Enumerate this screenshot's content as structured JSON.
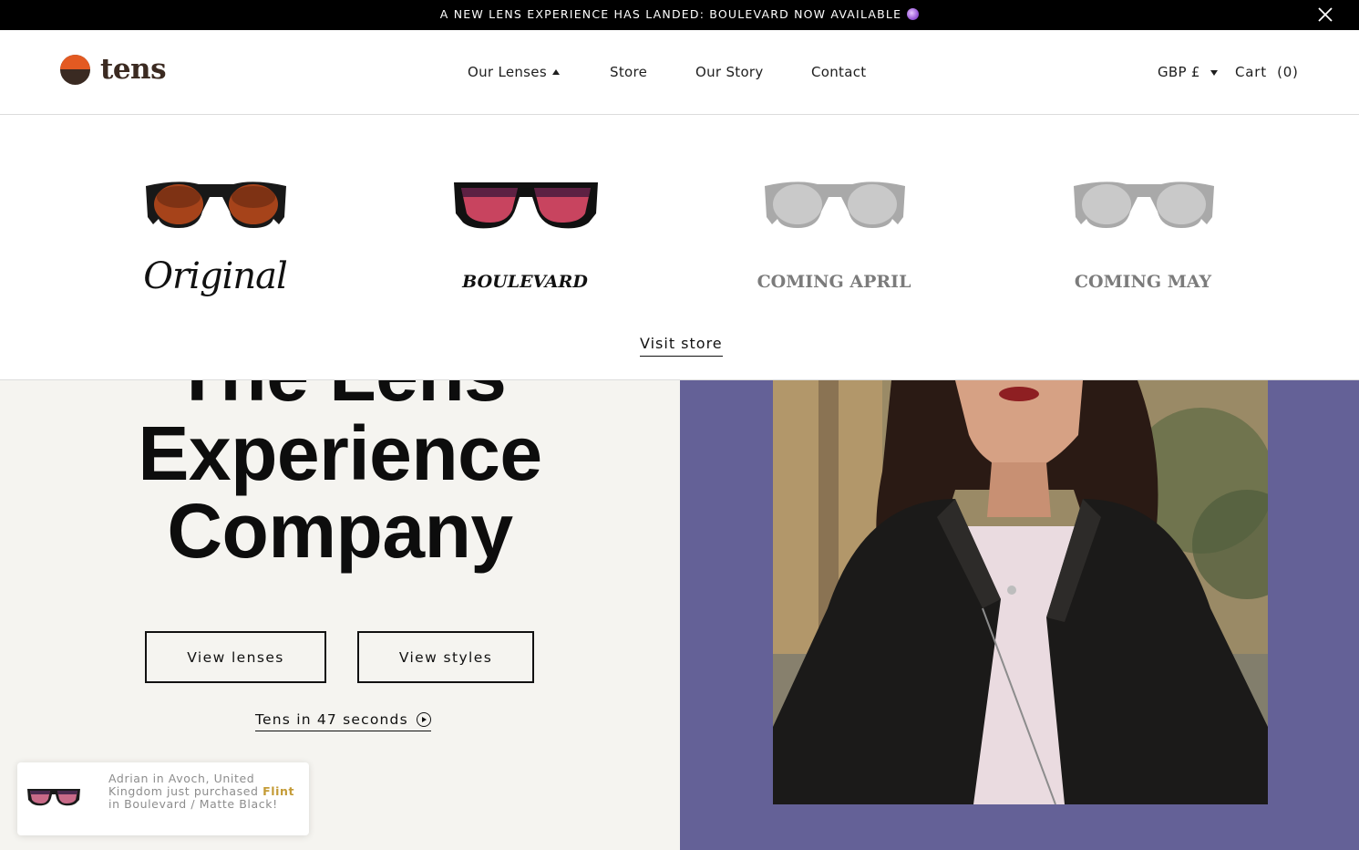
{
  "announcement": {
    "text": "A NEW LENS EXPERIENCE HAS LANDED: BOULEVARD NOW AVAILABLE",
    "emoji_icon": "crystal-ball-icon",
    "close_icon": "close-icon"
  },
  "header": {
    "logo_text": "tens",
    "nav": [
      {
        "label": "Our Lenses",
        "expanded": true
      },
      {
        "label": "Store"
      },
      {
        "label": "Our Story"
      },
      {
        "label": "Contact"
      }
    ],
    "currency": "GBP £",
    "cart_label": "Cart",
    "cart_count": "(0)"
  },
  "mega_menu": {
    "lenses": [
      {
        "label": "Original",
        "style": "script",
        "tint": "#b24a14"
      },
      {
        "label": "BOULEVARD",
        "style": "italic-serif",
        "tint": "#c8445f"
      },
      {
        "label": "COMING APRIL",
        "style": "muted",
        "tint": "#bdbdbd"
      },
      {
        "label": "COMING MAY",
        "style": "muted",
        "tint": "#bdbdbd"
      }
    ],
    "visit_store": "Visit store"
  },
  "hero": {
    "title_line1": "The Lens",
    "title_line2": "Experience",
    "title_line3": "Company",
    "btn_lenses": "View lenses",
    "btn_styles": "View styles",
    "video_link": "Tens in 47 seconds",
    "panel_color": "#646197",
    "background_color": "#f5f4f0"
  },
  "toast": {
    "text_before": "Adrian in Avoch, United Kingdom just purchased",
    "product": "Flint",
    "text_after": "in Boulevard / Matte Black!"
  },
  "colors": {
    "brand_orange": "#e35a22",
    "brand_brown": "#3b2a21",
    "highlight": "#c49b36"
  }
}
